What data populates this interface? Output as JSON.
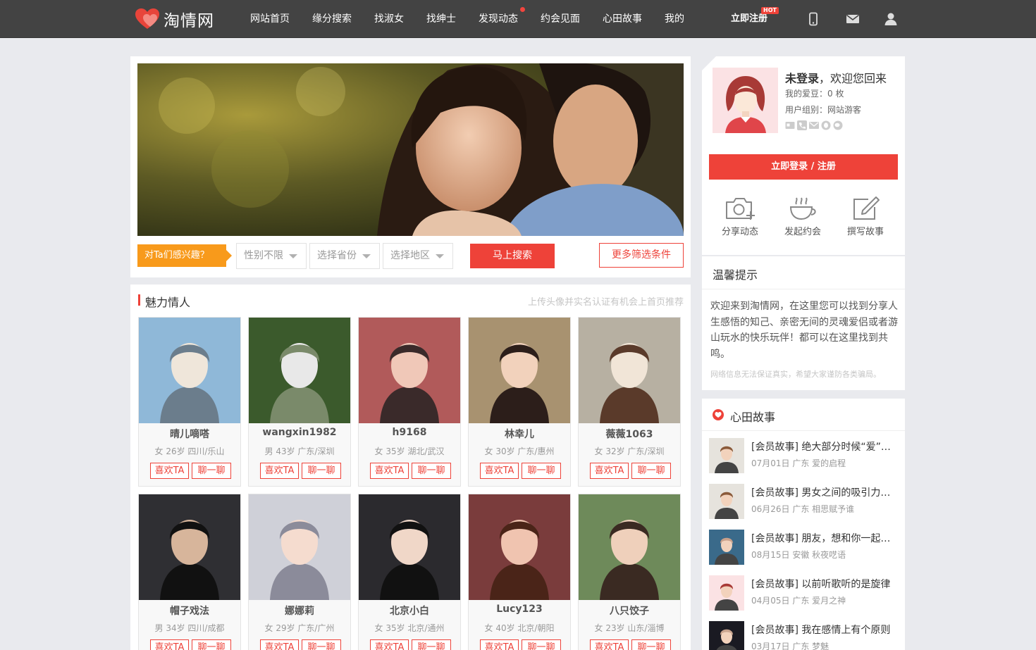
{
  "header": {
    "logo_text": "淘情网",
    "nav": [
      "网站首页",
      "缘分搜索",
      "找淑女",
      "找绅士",
      "发现动态",
      "约会见面",
      "心田故事",
      "我的"
    ],
    "register": "立即注册",
    "hot_badge": "HOT",
    "icons": [
      "mobile-icon",
      "mail-icon",
      "user-icon"
    ]
  },
  "search": {
    "interest_label": "对Ta们感兴趣？",
    "gender": "性别不限",
    "province": "选择省份",
    "region": "选择地区",
    "search_button": "马上搜索",
    "more_button": "更多筛选条件"
  },
  "members": {
    "title": "魅力情人",
    "hint": "上传头像并实名认证有机会上首页推荐",
    "like_label": "喜欢TA",
    "chat_label": "聊一聊",
    "list": [
      {
        "name": "晴儿嘀嗒",
        "info": "女 26岁 四川/乐山"
      },
      {
        "name": "wangxin1982",
        "info": "男 43岁 广东/深圳"
      },
      {
        "name": "h9168",
        "info": "女 35岁 湖北/武汉"
      },
      {
        "name": "林幸儿",
        "info": "女 30岁 广东/惠州"
      },
      {
        "name": "薇薇1063",
        "info": "女 32岁 广东/深圳"
      },
      {
        "name": "帽子戏法",
        "info": "男 34岁 四川/成都"
      },
      {
        "name": "娜娜莉",
        "info": "女 29岁 广东/广州"
      },
      {
        "name": "北京小白",
        "info": "女 35岁 北京/通州"
      },
      {
        "name": "Lucy123",
        "info": "女 40岁 北京/朝阳"
      },
      {
        "name": "八只饺子",
        "info": "女 23岁 山东/淄博"
      }
    ]
  },
  "user": {
    "status": "未登录",
    "welcome": "，欢迎您回来",
    "beans": "我的爱豆：0 枚",
    "group": "用户组别：网站游客",
    "login_button": "立即登录 / 注册",
    "actions": [
      "分享动态",
      "发起约会",
      "撰写故事"
    ]
  },
  "tips": {
    "title": "温馨提示",
    "text": "欢迎来到淘情网，在这里您可以找到分享人生感悟的知己、亲密无间的灵魂爱侣或者游山玩水的快乐玩伴！都可以在这里找到共鸣。",
    "warning": "网络信息无法保证真实，希望大家谨防各类骗局。"
  },
  "stories": {
    "title": "心田故事",
    "list": [
      {
        "title": "[会员故事] 绝大部分时候“爱”是…",
        "meta": "07月01日 广东 爱的启程"
      },
      {
        "title": "[会员故事] 男女之间的吸引力很…",
        "meta": "06月26日 广东 相思赋予谁"
      },
      {
        "title": "[会员故事] 朋友，想和你一起去…",
        "meta": "08月15日 安徽 秋夜呓语"
      },
      {
        "title": "[会员故事] 以前听歌听的是旋律",
        "meta": "04月05日 广东 爱月之神"
      },
      {
        "title": "[会员故事] 我在感情上有个原则",
        "meta": "03月17日 广东 梦魅"
      }
    ]
  },
  "colors": {
    "accent": "#ee4239",
    "topbar": "#434343",
    "orange": "#f89a1b"
  }
}
